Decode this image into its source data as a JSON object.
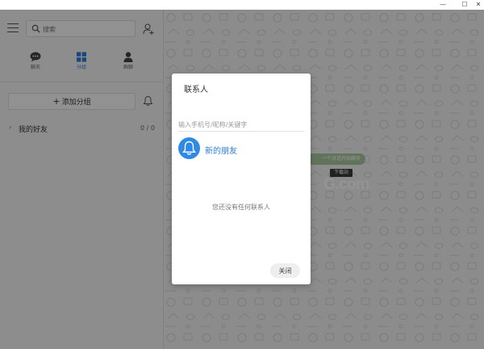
{
  "window": {
    "minimize_glyph": "—",
    "maximize_glyph": "☐",
    "close_glyph": "✕"
  },
  "sidebar": {
    "search_placeholder": "搜索",
    "tabs": [
      {
        "label": "聊天",
        "icon": "chat-bubble-icon",
        "active": false
      },
      {
        "label": "分组",
        "icon": "grid-icon",
        "active": true
      },
      {
        "label": "群聊",
        "icon": "people-icon",
        "active": false
      }
    ],
    "add_group_plus": "+",
    "add_group_label": "添加分组",
    "groups": [
      {
        "arrow": "›",
        "name": "我的好友",
        "count": "0 / 0"
      }
    ]
  },
  "main": {
    "hint_text": "一个对话开始聊天",
    "watermark_badge": "下载站",
    "watermark_text": "G.com"
  },
  "dialog": {
    "title": "联系人",
    "search_placeholder": "输入手机号/昵称/关键字",
    "new_friend_label": "新的朋友",
    "empty_text": "您还没有任何联系人",
    "close_label": "关闭"
  },
  "colors": {
    "accent_blue": "#2f8ae6",
    "hint_green": "#a7c89d",
    "overlay": "rgba(0,0,0,0.42)"
  }
}
